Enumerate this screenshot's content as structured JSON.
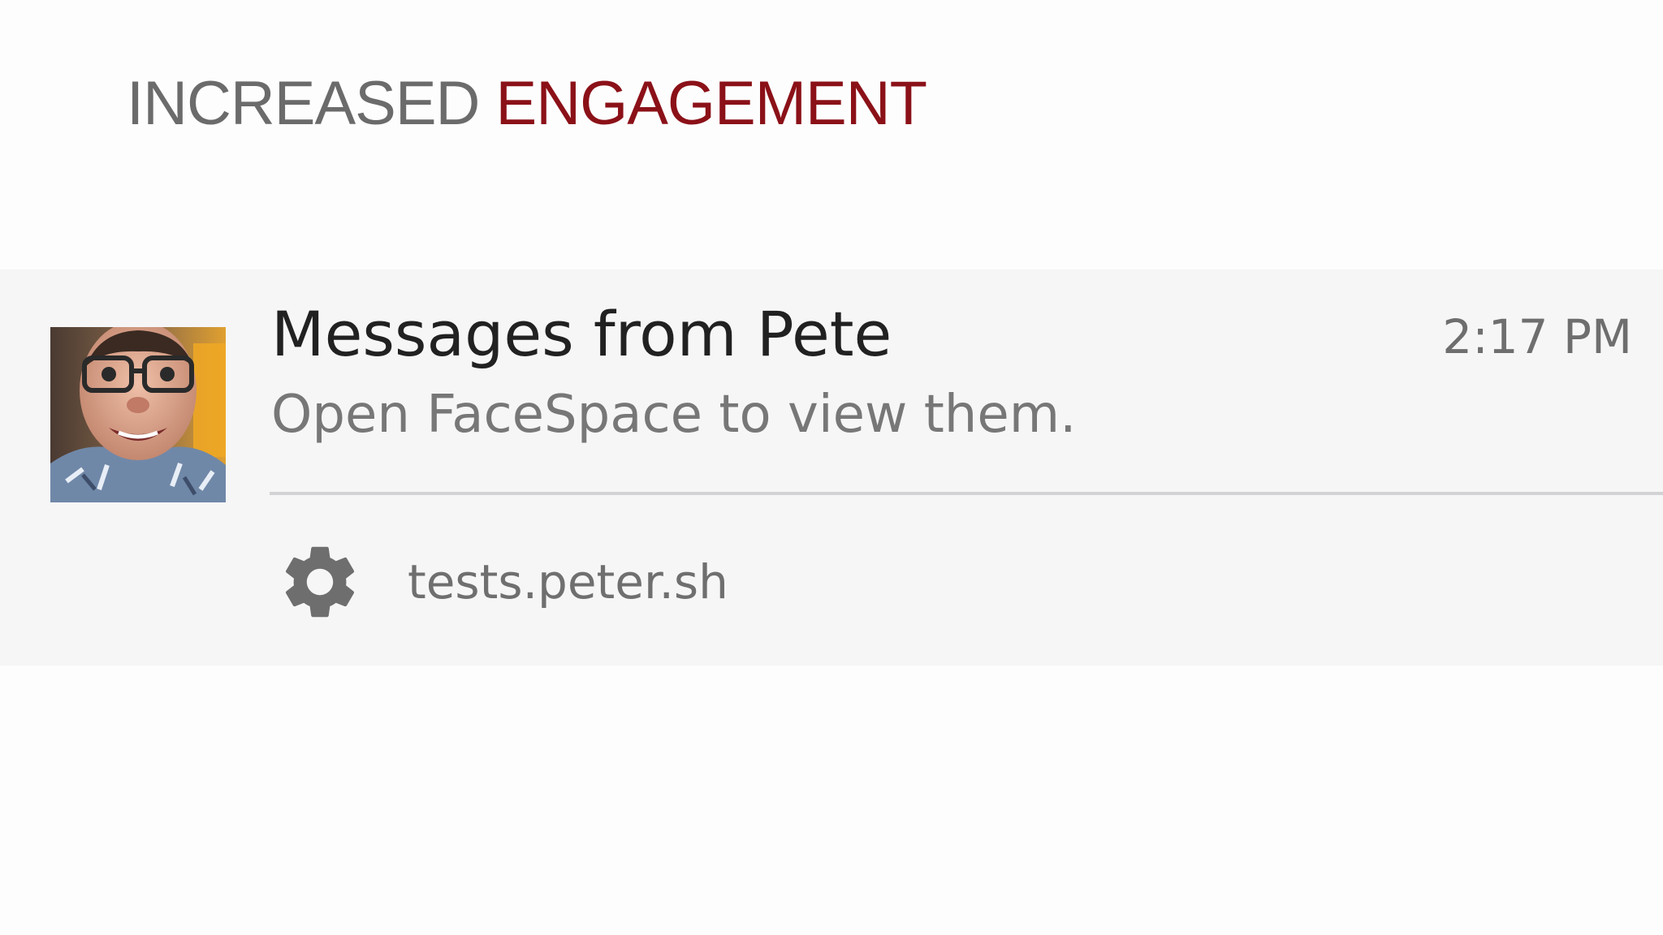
{
  "slide": {
    "title_plain": "INCREASED ",
    "title_accent": "ENGAGEMENT",
    "accent_color": "#8b1118"
  },
  "notification": {
    "avatar": "avatar-photo",
    "title": "Messages from Pete",
    "time": "2:17 PM",
    "body": "Open FaceSpace to view them.",
    "settings_icon": "gear-icon",
    "origin": "tests.peter.sh"
  }
}
